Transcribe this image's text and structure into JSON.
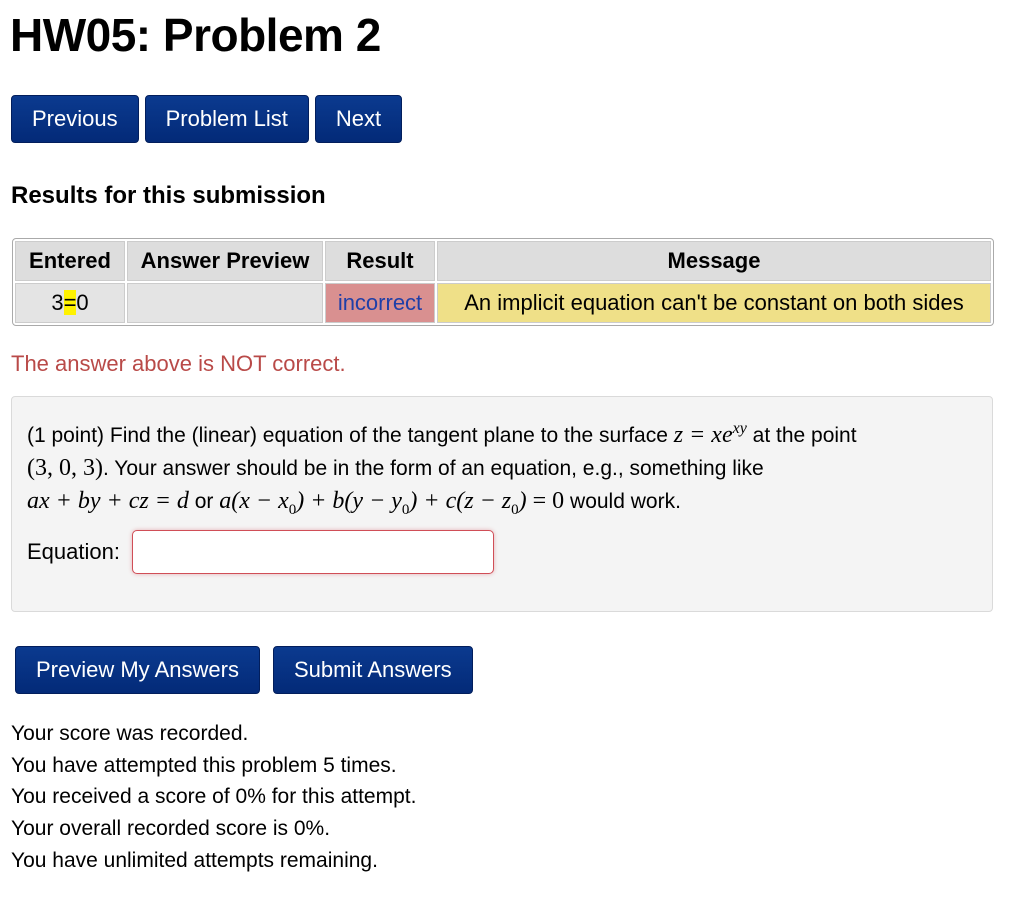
{
  "page": {
    "title": "HW05: Problem 2"
  },
  "nav": {
    "previous": "Previous",
    "problem_list": "Problem List",
    "next": "Next"
  },
  "results": {
    "heading": "Results for this submission",
    "headers": {
      "entered": "Entered",
      "answer_preview": "Answer Preview",
      "result": "Result",
      "message": "Message"
    },
    "row": {
      "entered_left": "3",
      "entered_mid": "=",
      "entered_right": "0",
      "answer_preview": "",
      "result": "incorrect",
      "message": "An implicit equation can't be constant on both sides"
    },
    "verdict": "The answer above is NOT correct."
  },
  "problem": {
    "points": "(1 point)",
    "text_1": " Find the (linear) equation of the tangent plane to the surface ",
    "text_2": " at the point",
    "text_3": ". Your answer should be in the form of an equation, e.g., something like",
    "text_4": " or ",
    "text_5": " would work.",
    "math_surface": "z = xe",
    "math_surface_exp": "xy",
    "math_point": "(3, 0, 3)",
    "math_form1": "ax + by + cz = d",
    "equation_label": "Equation:",
    "equation_value": ""
  },
  "actions": {
    "preview": "Preview My Answers",
    "submit": "Submit Answers"
  },
  "status": {
    "line1": "Your score was recorded.",
    "line2": "You have attempted this problem 5 times.",
    "line3": "You received a score of 0% for this attempt.",
    "line4": "Your overall recorded score is 0%.",
    "line5": "You have unlimited attempts remaining."
  },
  "colors": {
    "button": "#032a78",
    "incorrect_bg": "#d99090",
    "message_bg": "#efe088",
    "verdict_text": "#b94a48"
  }
}
